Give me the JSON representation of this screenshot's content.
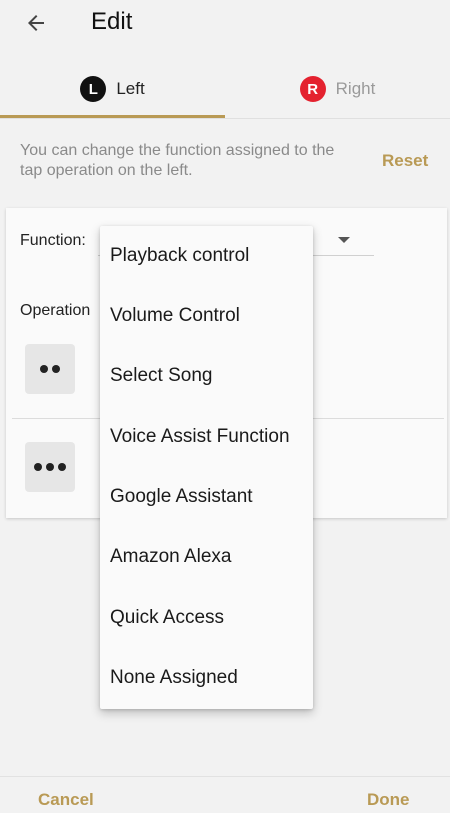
{
  "header": {
    "title": "Edit",
    "back_icon": "arrow-left-icon"
  },
  "tabs": [
    {
      "badge": "L",
      "label": "Left",
      "selected": true,
      "badge_color": "#111111"
    },
    {
      "badge": "R",
      "label": "Right",
      "selected": false,
      "badge_color": "#e4222f"
    }
  ],
  "description": {
    "text": "You can change the function assigned to the tap operation on the left.",
    "reset_label": "Reset"
  },
  "card": {
    "function_label": "Function:",
    "operation_label": "Operation"
  },
  "dropdown": {
    "options": [
      "Playback control",
      "Volume Control",
      "Select Song",
      "Voice Assist Function",
      "Google Assistant",
      "Amazon Alexa",
      "Quick Access",
      "None Assigned"
    ]
  },
  "footer": {
    "cancel_label": "Cancel",
    "done_label": "Done"
  },
  "colors": {
    "accent": "#b99a55",
    "background": "#f2f2f2"
  }
}
